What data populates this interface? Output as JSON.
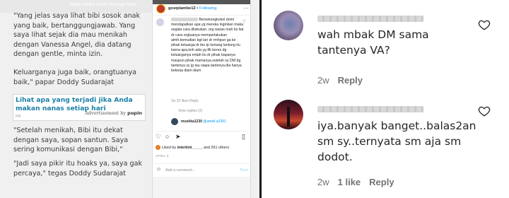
{
  "article": {
    "paragraphs": [
      "\"Yang jelas saya lihat bibi sosok anak yang baik, bertanggungjawab. Yang saya lihat sejak dia mau menikah dengan Vanessa Angel, dia datang dengan gentle, minta izin.",
      "Keluarganya juga baik, orangtuanya baik,\" papar Doddy Sudarajat",
      "\"Setelah menikah, Bibi itu dekat dengan saya, sopan santun. Saya sering komunikasi dengan Bibi,\"",
      "\"Jadi saya pikir itu hoaks ya, saya gak percaya,\" tegas Doddy Sudarajat"
    ],
    "ad": {
      "title": "Lihat apa yang terjadi jika Anda makan nanas setiap hari",
      "note": "Advertisement by",
      "brand": "popIn",
      "flag": "PR"
    },
    "headline_snip": "Malah Sebut Galih Ginanjar Bala..."
  },
  "instagram": {
    "username": "gosiplambe12",
    "follow": "Following",
    "more": "···",
    "comment": "Bersekongkokol demi mendapatkan apa yg mereka inginkan maka segala cara dilakukan..org waras mah bs liat dr cara orgtuanya memperlakukan almh.kemudian bgt lari dr rmhpun ga ke pihak keluarga dr ibu tp luntang lantung itu karna apa,knh ada yg tfk beres dg keluarganya entah itu dr pihak bapanya maupun pihak mamanya.setelah sy DM dg tantenya sy jg tau siapa tantenya.dia hanya bekerja diam diam",
    "meta": "2w   32 likes   Reply",
    "view_replies": "View replies (2)",
    "reply_user": "mustika1230",
    "reply_mention": "@ameli.a2391",
    "liked_by": "Liked by",
    "liked_user": "interkini_____",
    "liked_rest": "and 261 others",
    "date": "APRIL 6",
    "add_comment": "Add a comment...",
    "post": "Post"
  },
  "comments": [
    {
      "text": "wah mbak DM sama tantenya VA?",
      "time": "2w",
      "reply": "Reply",
      "likes": ""
    },
    {
      "text": "iya.banyak banget..balas2an sm sy..ternyata sm aja sm dodot.",
      "time": "2w",
      "likes": "1 like",
      "reply": "Reply"
    }
  ],
  "colors": {
    "link": "#0095f6",
    "ad_title": "#1a7fa6",
    "muted": "#737373"
  }
}
